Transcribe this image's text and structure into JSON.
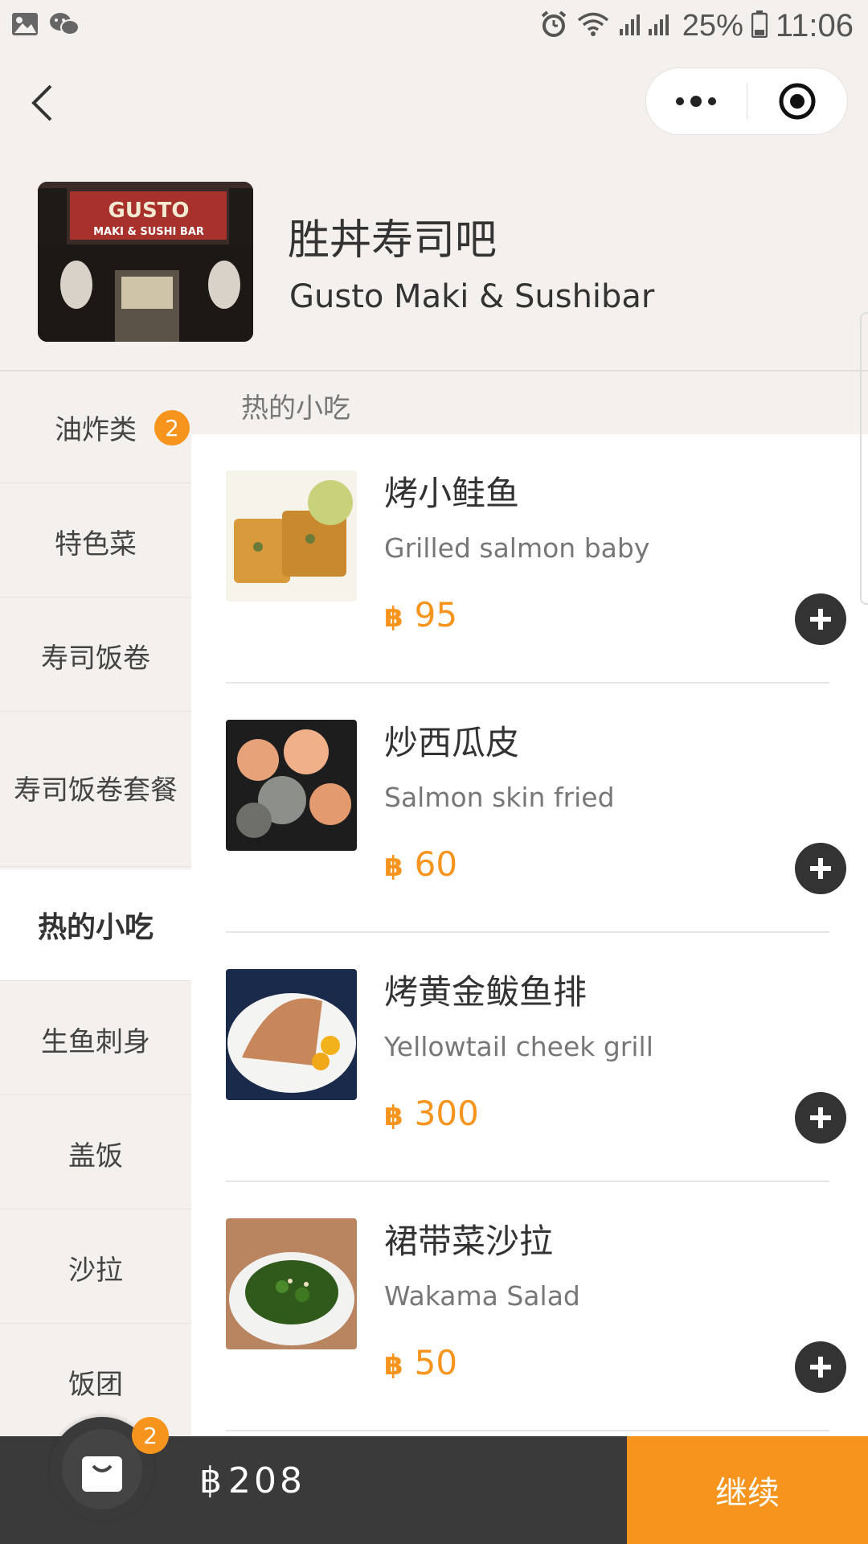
{
  "status_bar": {
    "battery": "25%",
    "time": "11:06",
    "icons": [
      "image-icon",
      "wechat-icon",
      "alarm-icon",
      "wifi-icon",
      "signal-icon",
      "battery-icon"
    ]
  },
  "restaurant": {
    "name_cn": "胜丼寿司吧",
    "name_en": "Gusto Maki & Sushibar",
    "sign_text": "GUSTO",
    "sign_subtext": "MAKI & SUSHI BAR"
  },
  "categories": [
    {
      "label": "油炸类",
      "badge": "2"
    },
    {
      "label": "特色菜"
    },
    {
      "label": "寿司饭卷"
    },
    {
      "label": "寿司饭卷套餐"
    },
    {
      "label": "热的小吃"
    },
    {
      "label": "生鱼刺身"
    },
    {
      "label": "盖饭"
    },
    {
      "label": "沙拉"
    },
    {
      "label": "饭团"
    }
  ],
  "section": {
    "title": "热的小吃"
  },
  "items": [
    {
      "name_cn": "烤小鲑鱼",
      "name_en": "Grilled salmon baby",
      "currency": "฿",
      "price": "95"
    },
    {
      "name_cn": "炒西瓜皮",
      "name_en": "Salmon skin fried",
      "currency": "฿",
      "price": "60"
    },
    {
      "name_cn": "烤黄金鲅鱼排",
      "name_en": "Yellowtail cheek grill",
      "currency": "฿",
      "price": "300"
    },
    {
      "name_cn": "裙带菜沙拉",
      "name_en": "Wakama Salad",
      "currency": "฿",
      "price": "50"
    }
  ],
  "cart": {
    "badge": "2",
    "currency": "฿",
    "total": "208",
    "checkout_label": "继续"
  },
  "colors": {
    "accent": "#f7941d",
    "dark": "#3a3a3a",
    "background": "#f4f0ee"
  }
}
